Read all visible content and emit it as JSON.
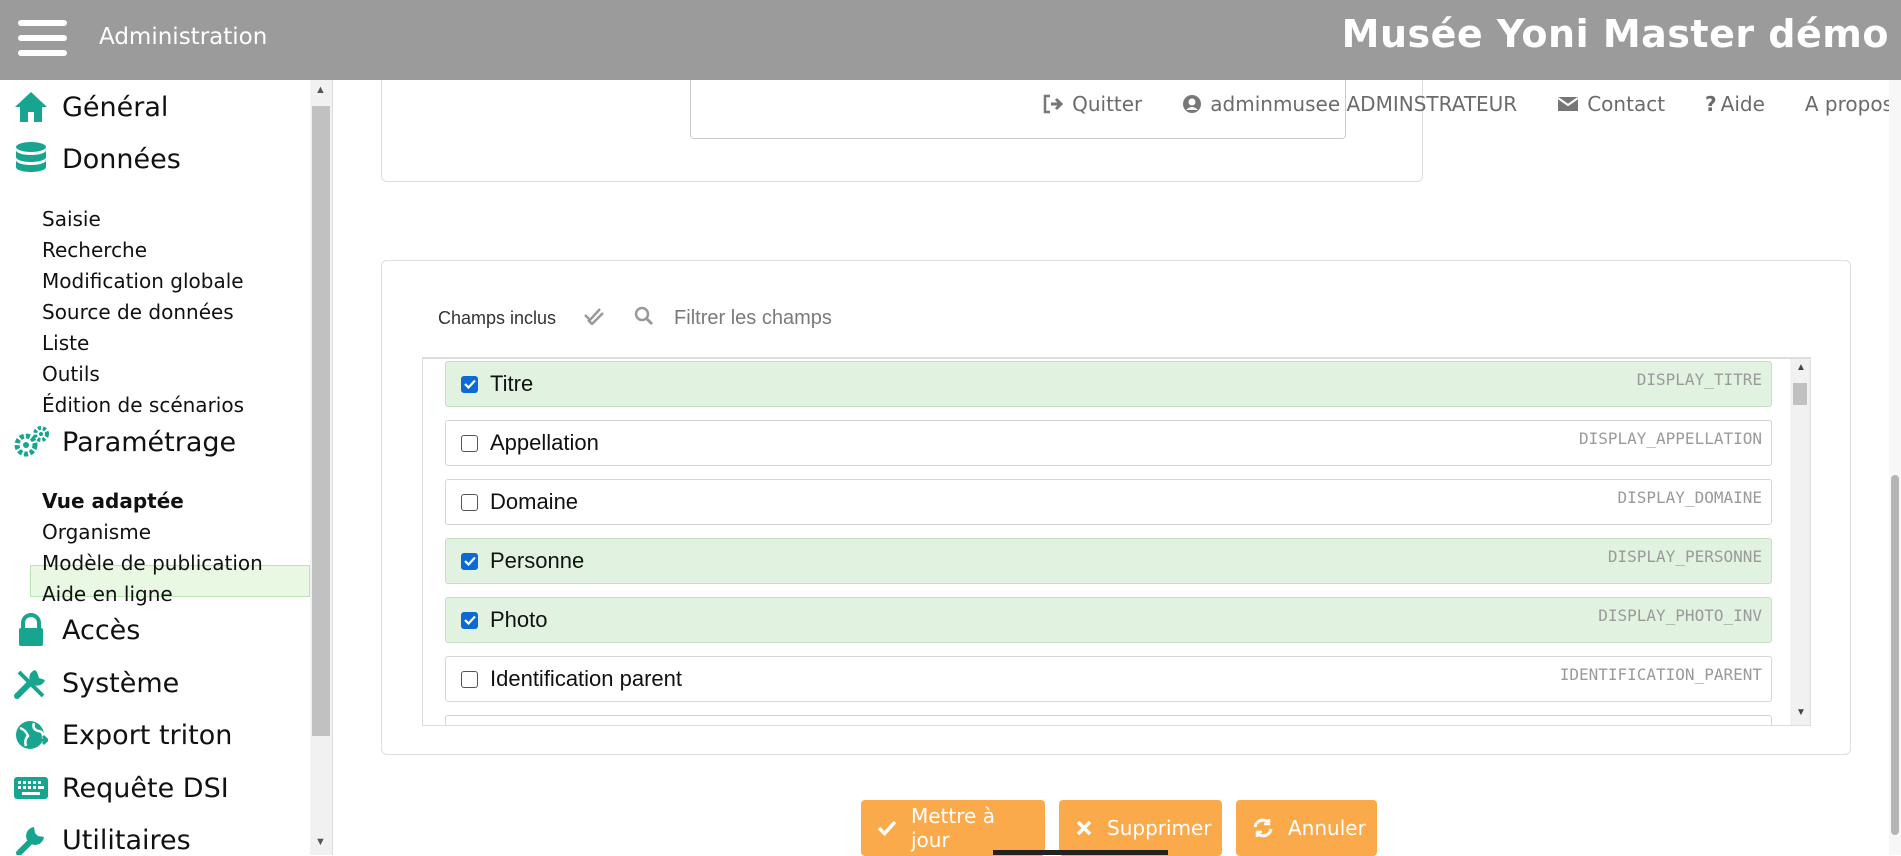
{
  "header": {
    "admin_label": "Administration",
    "site_title": "Musée Yoni Master démo"
  },
  "sidebar": {
    "general": "Général",
    "donnees": "Données",
    "donnees_items": [
      "Saisie",
      "Recherche",
      "Modification globale",
      "Source de données",
      "Liste",
      "Outils",
      "Édition de scénarios"
    ],
    "parametrage": "Paramétrage",
    "parametrage_items": [
      "Vue adaptée",
      "Organisme",
      "Modèle de publication",
      "Aide en ligne"
    ],
    "acces": "Accès",
    "systeme": "Système",
    "export": "Export triton",
    "requete": "Requête DSI",
    "utilitaires": "Utilitaires"
  },
  "util_bar": {
    "quit": "Quitter",
    "user": "adminmusee ADMINSTRATEUR",
    "contact": "Contact",
    "help": "Aide",
    "about": "A propos"
  },
  "fields_panel": {
    "included_label": "Champs inclus",
    "filter_placeholder": "Filtrer les champs",
    "fields": [
      {
        "name": "Titre",
        "code": "DISPLAY_TITRE",
        "checked": true
      },
      {
        "name": "Appellation",
        "code": "DISPLAY_APPELLATION",
        "checked": false
      },
      {
        "name": "Domaine",
        "code": "DISPLAY_DOMAINE",
        "checked": false
      },
      {
        "name": "Personne",
        "code": "DISPLAY_PERSONNE",
        "checked": true
      },
      {
        "name": "Photo",
        "code": "DISPLAY_PHOTO_INV",
        "checked": true
      },
      {
        "name": "Identification parent",
        "code": "IDENTIFICATION_PARENT",
        "checked": false
      }
    ]
  },
  "actions": {
    "update": "Mettre à jour",
    "delete": "Supprimer",
    "cancel": "Annuler"
  },
  "colors": {
    "header_bg": "#9b9b9b",
    "accent_teal": "#17a58f",
    "button_orange": "#fbaa4b",
    "row_checked_bg": "#e2f2e0"
  }
}
